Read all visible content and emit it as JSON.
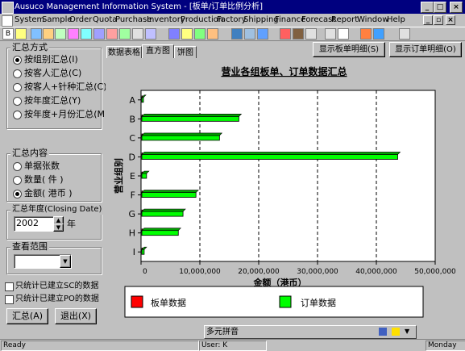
{
  "window": {
    "title": "Ausuco Management Information System - [板单/订单比例分析]"
  },
  "menu": [
    "System",
    "Sample",
    "Order",
    "Quota",
    "Purchase",
    "Inventory",
    "Production",
    "Factory",
    "Shipping",
    "Finance",
    "Forecast",
    "Report",
    "Window",
    "Help"
  ],
  "summary_mode": {
    "title": "汇总方式",
    "options": [
      "按组别汇总(I)",
      "按客人汇总(C)",
      "按客人+针种汇总(C)",
      "按年度汇总(Y)",
      "按年度+月份汇总(M)"
    ],
    "selected": 0
  },
  "summary_content": {
    "title": "汇总内容",
    "options": [
      "单据张数",
      "数量( 件 )",
      "金额( 港币 )"
    ],
    "selected": 2
  },
  "year": {
    "title": "汇总年度(Closing Date)",
    "value": "2002",
    "unit": "年"
  },
  "scope": {
    "title": "查看范围",
    "value": ""
  },
  "checks": [
    "只统计已建立SC的数据",
    "只统计已建立PO的数据"
  ],
  "buttons": {
    "summarize": "汇总(A)",
    "exit": "退出(X)"
  },
  "tabs": [
    "数据表格",
    "直方图",
    "饼图"
  ],
  "active_tab": 1,
  "top_buttons": {
    "show_sample": "显示板单明细(S)",
    "show_order": "显示订单明细(O)"
  },
  "chart_data": {
    "type": "bar",
    "orientation": "horizontal",
    "title": "营业各组板单、订单数据汇总",
    "xlabel": "金额（港币）",
    "ylabel": "营业组别",
    "xlim": [
      0,
      50000000
    ],
    "xticks": [
      "0",
      "10,000,000",
      "20,000,000",
      "30,000,000",
      "40,000,000",
      "50,000,000"
    ],
    "grid": true,
    "legend_placement": "bottom",
    "categories": [
      "A",
      "B",
      "C",
      "D",
      "E",
      "F",
      "G",
      "H",
      "I"
    ],
    "series": [
      {
        "name": "板单数据",
        "color": "#ff0000",
        "values": [
          0,
          0,
          0,
          0,
          0,
          0,
          0,
          0,
          0
        ]
      },
      {
        "name": "订单数据",
        "color": "#00ff00",
        "values": [
          200000,
          16500000,
          13200000,
          43500000,
          800000,
          9200000,
          7000000,
          6200000,
          400000
        ]
      }
    ]
  },
  "ime": {
    "label": "多元拼音"
  },
  "status": {
    "ready": "Ready",
    "user": "User: K",
    "day": "Monday"
  }
}
